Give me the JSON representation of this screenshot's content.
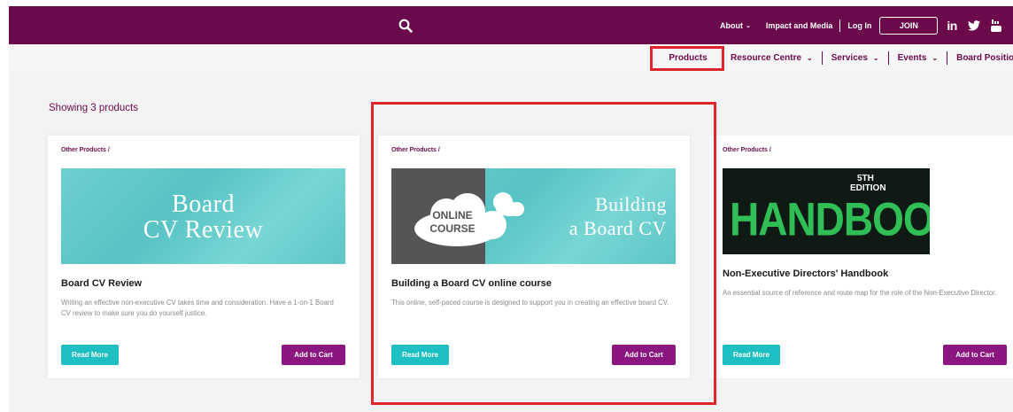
{
  "topbar": {
    "nav": {
      "about": "About",
      "impact": "Impact and Media",
      "login": "Log In",
      "join": "JOIN"
    },
    "social": {
      "linkedin": "in"
    },
    "colors": {
      "brand": "#6a0a4a"
    }
  },
  "subnav": {
    "products": "Products",
    "resource_centre": "Resource Centre",
    "services": "Services",
    "events": "Events",
    "board_positions": "Board Positio"
  },
  "main": {
    "showing": "Showing 3 products",
    "products": [
      {
        "crumb": "Other Products /",
        "image_text_1": "Board",
        "image_text_2": "CV Review",
        "title": "Board CV Review",
        "desc": "Writing an effective non-executive CV takes time and consideration. Have a 1-on-1 Board CV review to make sure you do yourself justice.",
        "read_more": "Read More",
        "add_to_cart": "Add to Cart"
      },
      {
        "crumb": "Other Products /",
        "image_cloud_1": "ONLINE",
        "image_cloud_2": "COURSE",
        "image_text_1": "Building",
        "image_text_2": "a Board CV",
        "title": "Building a Board CV online course",
        "desc": "This online, self-paced course is designed to support you in creating an effective board CV.",
        "read_more": "Read More",
        "add_to_cart": "Add to Cart"
      },
      {
        "crumb": "Other Products /",
        "image_edition_1": "5TH",
        "image_edition_2": "EDITION",
        "image_text": "HANDBOOK",
        "title": "Non-Executive Directors' Handbook",
        "desc": "An essential source of reference and route map for the role of the Non-Executive Director.",
        "read_more": "Read More",
        "add_to_cart": "Add to Cart"
      }
    ]
  },
  "colors": {
    "accent_teal": "#1dbfc2",
    "cart_purple": "#8b1680",
    "highlight_red": "#e0242c"
  }
}
